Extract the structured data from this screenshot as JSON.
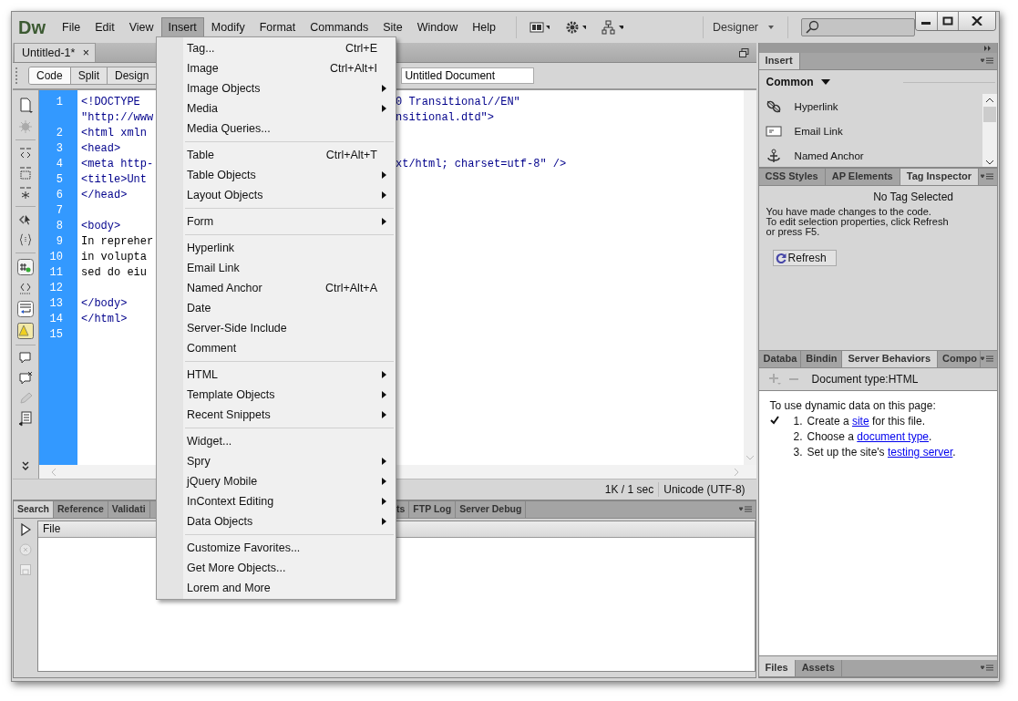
{
  "app": {
    "logo": "Dw",
    "workspace": "Designer"
  },
  "menubar": [
    {
      "label": "File",
      "selected": false
    },
    {
      "label": "Edit",
      "selected": false
    },
    {
      "label": "View",
      "selected": false
    },
    {
      "label": "Insert",
      "selected": true
    },
    {
      "label": "Modify",
      "selected": false
    },
    {
      "label": "Format",
      "selected": false
    },
    {
      "label": "Commands",
      "selected": false
    },
    {
      "label": "Site",
      "selected": false
    },
    {
      "label": "Window",
      "selected": false
    },
    {
      "label": "Help",
      "selected": false
    }
  ],
  "insert_menu": [
    {
      "kind": "item",
      "label": "Tag...",
      "shortcut": "Ctrl+E",
      "submenu": false
    },
    {
      "kind": "item",
      "label": "Image",
      "shortcut": "Ctrl+Alt+I",
      "submenu": false
    },
    {
      "kind": "item",
      "label": "Image Objects",
      "submenu": true
    },
    {
      "kind": "item",
      "label": "Media",
      "submenu": true
    },
    {
      "kind": "item",
      "label": "Media Queries...",
      "submenu": false
    },
    {
      "kind": "separator"
    },
    {
      "kind": "item",
      "label": "Table",
      "shortcut": "Ctrl+Alt+T",
      "submenu": false
    },
    {
      "kind": "item",
      "label": "Table Objects",
      "submenu": true
    },
    {
      "kind": "item",
      "label": "Layout Objects",
      "submenu": true
    },
    {
      "kind": "separator"
    },
    {
      "kind": "item",
      "label": "Form",
      "submenu": true
    },
    {
      "kind": "separator"
    },
    {
      "kind": "item",
      "label": "Hyperlink",
      "submenu": false
    },
    {
      "kind": "item",
      "label": "Email Link",
      "submenu": false
    },
    {
      "kind": "item",
      "label": "Named Anchor",
      "shortcut": "Ctrl+Alt+A",
      "submenu": false
    },
    {
      "kind": "item",
      "label": "Date",
      "submenu": false
    },
    {
      "kind": "item",
      "label": "Server-Side Include",
      "submenu": false
    },
    {
      "kind": "item",
      "label": "Comment",
      "submenu": false
    },
    {
      "kind": "separator"
    },
    {
      "kind": "item",
      "label": "HTML",
      "submenu": true
    },
    {
      "kind": "item",
      "label": "Template Objects",
      "submenu": true
    },
    {
      "kind": "item",
      "label": "Recent Snippets",
      "submenu": true
    },
    {
      "kind": "separator"
    },
    {
      "kind": "item",
      "label": "Widget...",
      "submenu": false
    },
    {
      "kind": "item",
      "label": "Spry",
      "submenu": true
    },
    {
      "kind": "item",
      "label": "jQuery Mobile",
      "submenu": true
    },
    {
      "kind": "item",
      "label": "InContext Editing",
      "submenu": true
    },
    {
      "kind": "item",
      "label": "Data Objects",
      "submenu": true
    },
    {
      "kind": "separator"
    },
    {
      "kind": "item",
      "label": "Customize Favorites...",
      "submenu": false
    },
    {
      "kind": "item",
      "label": "Get More Objects...",
      "submenu": false
    },
    {
      "kind": "item",
      "label": "Lorem and More",
      "submenu": false
    }
  ],
  "document_tab": {
    "title": "Untitled-1*",
    "close": "×"
  },
  "view_buttons": [
    {
      "label": "Code",
      "selected": true
    },
    {
      "label": "Split",
      "selected": false
    },
    {
      "label": "Design",
      "selected": false
    }
  ],
  "title_field": {
    "value": "Untitled Document"
  },
  "code_lines": [
    {
      "number": "1",
      "left": "<!DOCTYPE ",
      "right": "0 Transitional//EN\""
    },
    {
      "left": "\"http://www",
      "right": "nsitional.dtd\">"
    },
    {
      "number": "2",
      "left": "<html xmln"
    },
    {
      "number": "3",
      "left": "<head>"
    },
    {
      "number": "4",
      "left": "<meta http-",
      "right": "xt/html; charset=utf-8\" />"
    },
    {
      "number": "5",
      "left": "<title>Unt"
    },
    {
      "number": "6",
      "left": "</head>"
    },
    {
      "number": "7"
    },
    {
      "number": "8",
      "left": "<body>"
    },
    {
      "number": "9",
      "left": "In repreher"
    },
    {
      "number": "10",
      "left": "in volupta"
    },
    {
      "number": "11",
      "left": "sed do eiu"
    },
    {
      "number": "12"
    },
    {
      "number": "13",
      "left": "</body>"
    },
    {
      "number": "14",
      "left": "</html>"
    },
    {
      "number": "15"
    }
  ],
  "status_bar": {
    "size": "1K / 1 sec",
    "encoding": "Unicode (UTF-8)"
  },
  "results_panel": {
    "tabs": [
      {
        "label": "Search",
        "selected": true
      },
      {
        "label": "Reference",
        "selected": false
      },
      {
        "label": "Validati",
        "selected": false
      },
      {
        "label": "ts",
        "selected": false
      },
      {
        "label": "FTP Log",
        "selected": false
      },
      {
        "label": "Server Debug",
        "selected": false
      }
    ],
    "column": "File"
  },
  "insert_panel": {
    "tab": "Insert",
    "category": "Common",
    "items": [
      {
        "label": "Hyperlink"
      },
      {
        "label": "Email Link"
      },
      {
        "label": "Named Anchor"
      }
    ]
  },
  "inspector_panel": {
    "tabs": [
      {
        "label": "CSS Styles",
        "selected": false
      },
      {
        "label": "AP Elements",
        "selected": false
      },
      {
        "label": "Tag Inspector",
        "selected": true
      }
    ],
    "heading": "No Tag Selected",
    "message_lines": [
      "You have made changes to the code.",
      "To edit selection properties, click Refresh",
      "or press F5."
    ],
    "button": "Refresh"
  },
  "behaviors_panel": {
    "tabs": [
      {
        "label": "Databa",
        "selected": false
      },
      {
        "label": "Bindin",
        "selected": false
      },
      {
        "label": "Server Behaviors",
        "selected": true
      },
      {
        "label": "Compo",
        "selected": false
      }
    ],
    "document_type": "Document type:HTML",
    "intro": "To use dynamic data on this page:",
    "steps": [
      {
        "number": "1.",
        "before": "Create a ",
        "link": "site",
        "after": " for this file.",
        "done": true
      },
      {
        "number": "2.",
        "before": "Choose a ",
        "link": "document type",
        "after": ".",
        "done": false
      },
      {
        "number": "3.",
        "before": "Set up the site's ",
        "link": "testing server",
        "after": ".",
        "done": false
      }
    ]
  },
  "files_panel": {
    "tabs": [
      {
        "label": "Files",
        "selected": true
      },
      {
        "label": "Assets",
        "selected": false
      }
    ]
  }
}
